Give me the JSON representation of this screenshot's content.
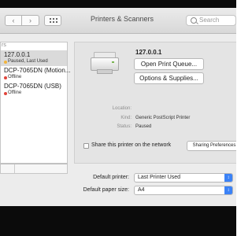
{
  "window": {
    "title": "Printers & Scanners"
  },
  "search": {
    "placeholder": "Search"
  },
  "sidebar": {
    "header": "rs",
    "items": [
      {
        "name": "127.0.0.1",
        "status": "Paused, Last Used",
        "status_color": "#f2b43a"
      },
      {
        "name": "DCP-7065DN (Motion...",
        "status": "Offline",
        "status_color": "#e0443b"
      },
      {
        "name": "DCP-7065DN (USB)",
        "status": "Offline",
        "status_color": "#e0443b"
      }
    ]
  },
  "detail": {
    "printer_name": "127.0.0.1",
    "buttons": {
      "open_queue": "Open Print Queue...",
      "options": "Options & Supplies..."
    },
    "info": {
      "location_label": "Location:",
      "location_value": "",
      "kind_label": "Kind:",
      "kind_value": "Generic PostScript Printer",
      "status_label": "Status:",
      "status_value": "Paused"
    },
    "share_label": "Share this printer on the network",
    "share_checked": false,
    "sharing_button": "Sharing Preferences"
  },
  "defaults": {
    "printer_label": "Default printer:",
    "printer_value": "Last Printer Used",
    "paper_label": "Default paper size:",
    "paper_value": "A4"
  },
  "colors": {
    "select_accent": "#3b82f6"
  }
}
